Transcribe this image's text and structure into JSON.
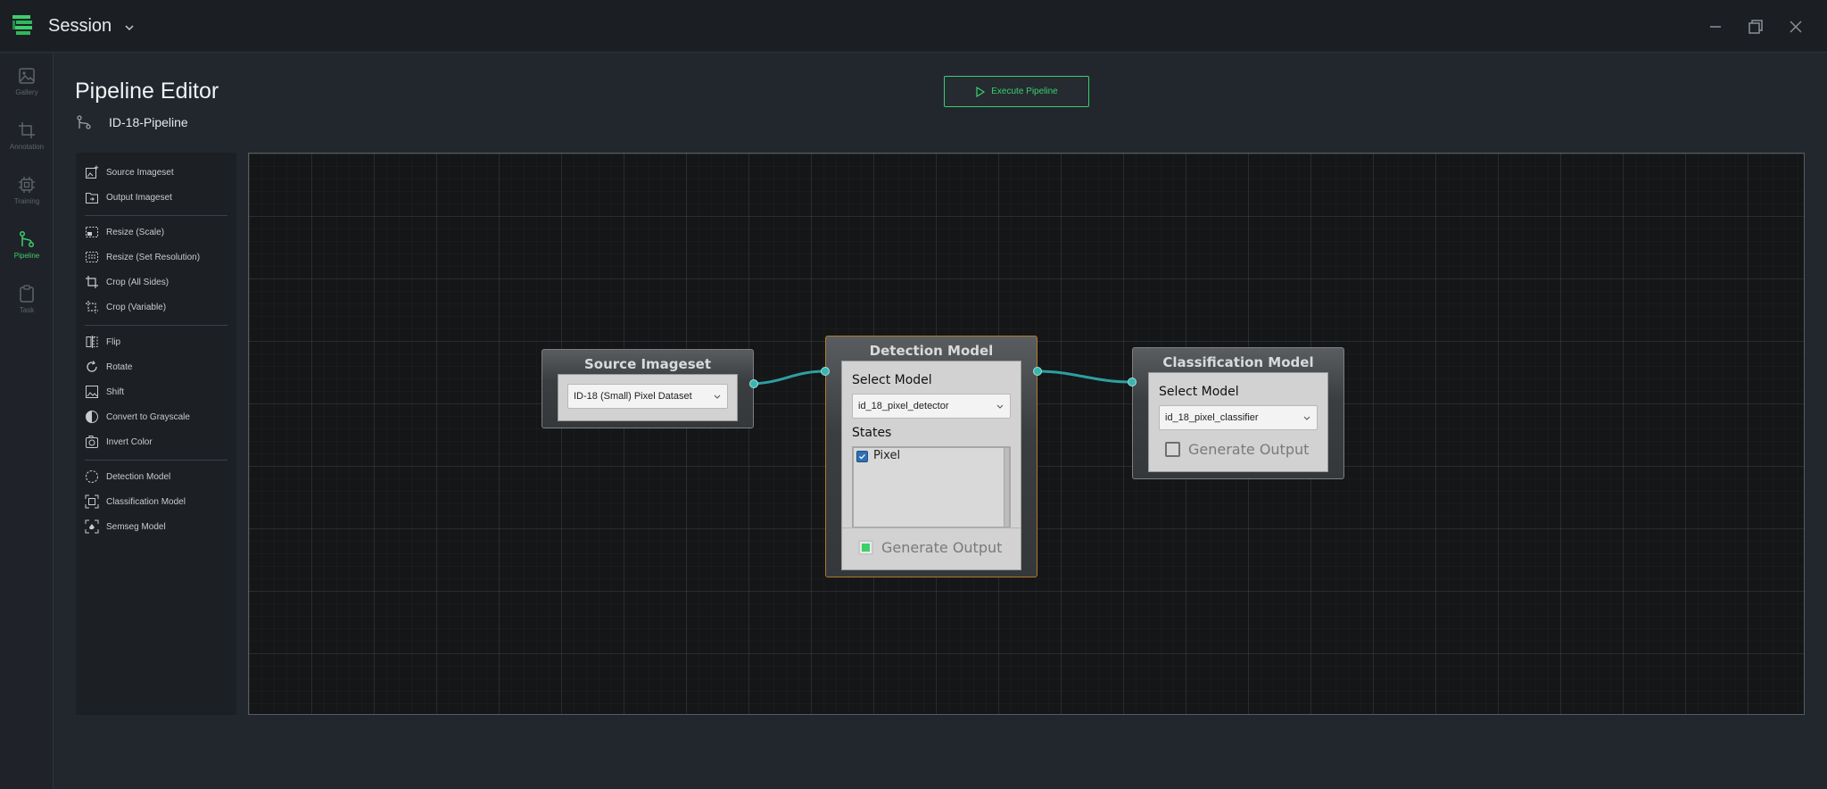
{
  "window": {
    "title": "Session"
  },
  "rail": {
    "items": [
      {
        "label": "Gallery",
        "icon": "image-icon"
      },
      {
        "label": "Annotation",
        "icon": "crop-icon"
      },
      {
        "label": "Training",
        "icon": "chip-icon"
      },
      {
        "label": "Pipeline",
        "icon": "pipeline-icon",
        "active": true
      },
      {
        "label": "Task",
        "icon": "clipboard-icon"
      }
    ]
  },
  "header": {
    "title": "Pipeline Editor",
    "pipeline_name": "ID-18-Pipeline",
    "execute_label": "Execute Pipeline"
  },
  "palette": {
    "items": [
      {
        "label": "Source Imageset",
        "icon": "image-add-icon"
      },
      {
        "label": "Output Imageset",
        "icon": "folder-export-icon"
      },
      {
        "label": "Resize (Scale)",
        "icon": "resize-scale-icon"
      },
      {
        "label": "Resize (Set Resolution)",
        "icon": "resize-resolution-icon"
      },
      {
        "label": "Crop (All Sides)",
        "icon": "crop-icon"
      },
      {
        "label": "Crop (Variable)",
        "icon": "crop-variable-icon"
      },
      {
        "label": "Flip",
        "icon": "flip-icon"
      },
      {
        "label": "Rotate",
        "icon": "rotate-icon"
      },
      {
        "label": "Shift",
        "icon": "shift-icon"
      },
      {
        "label": "Convert to Grayscale",
        "icon": "grayscale-icon"
      },
      {
        "label": "Invert Color",
        "icon": "invert-color-icon"
      },
      {
        "label": "Detection Model",
        "icon": "detection-icon"
      },
      {
        "label": "Classification Model",
        "icon": "classification-icon"
      },
      {
        "label": "Semseg Model",
        "icon": "semseg-icon"
      }
    ]
  },
  "nodes": {
    "source": {
      "title": "Source Imageset",
      "dataset": "ID-18 (Small) Pixel Dataset"
    },
    "detection": {
      "title": "Detection Model",
      "select_label": "Select Model",
      "model": "id_18_pixel_detector",
      "states_label": "States",
      "states": [
        {
          "label": "Pixel",
          "checked": true
        }
      ],
      "generate_label": "Generate Output",
      "generate_checked": true
    },
    "classification": {
      "title": "Classification Model",
      "select_label": "Select Model",
      "model": "id_18_pixel_classifier",
      "generate_label": "Generate Output",
      "generate_checked": false
    }
  },
  "colors": {
    "accent": "#3ccf6c",
    "wire": "#2e9fa0",
    "selected_node": "#b07a2a",
    "state_checkbox": "#2f6fb5"
  }
}
